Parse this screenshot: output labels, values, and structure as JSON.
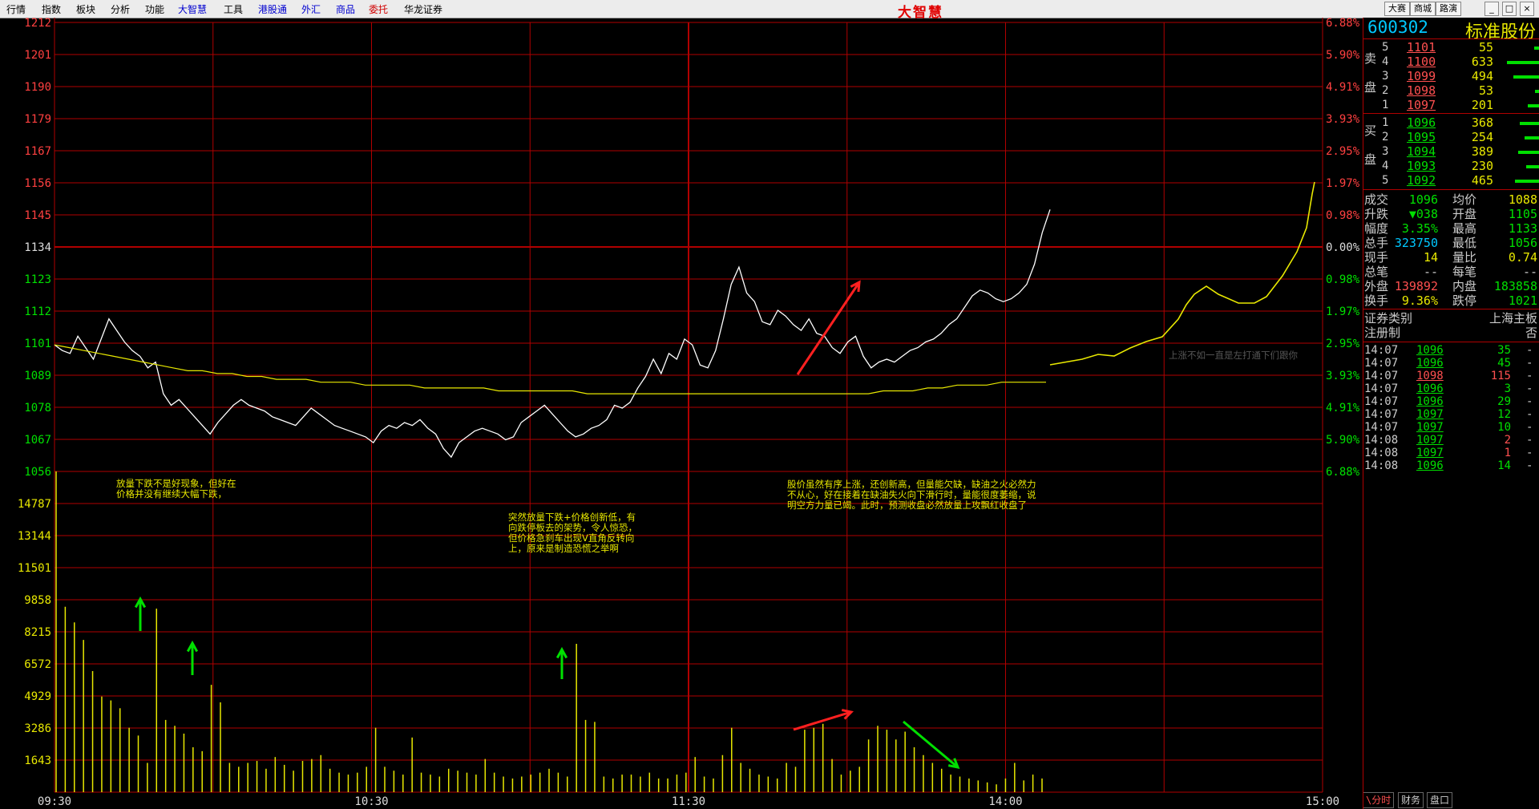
{
  "menu": [
    {
      "label": "行情",
      "style": ""
    },
    {
      "label": "指数",
      "style": ""
    },
    {
      "label": "板块",
      "style": ""
    },
    {
      "label": "分析",
      "style": ""
    },
    {
      "label": "功能",
      "style": ""
    },
    {
      "label": "大智慧",
      "style": "blue"
    },
    {
      "label": "工具",
      "style": ""
    },
    {
      "label": "港股通",
      "style": "blue"
    },
    {
      "label": "外汇",
      "style": "blue"
    },
    {
      "label": "商品",
      "style": "blue"
    },
    {
      "label": "委托",
      "style": "red"
    },
    {
      "label": "华龙证券",
      "style": ""
    }
  ],
  "logo": "大智慧",
  "topright": {
    "btn1": "大赛",
    "btn2": "商城",
    "btn3": "路演",
    "min": "_",
    "max": "□",
    "close": "×"
  },
  "stock": {
    "code": "600302",
    "name": "标准股份"
  },
  "orderbook": {
    "sell_side_label_1": "卖",
    "sell_side_label_2": "盘",
    "buy_side_label_1": "买",
    "buy_side_label_2": "盘",
    "sell": [
      {
        "level": "5",
        "price": "1101",
        "volume": "55",
        "bar": 0.15
      },
      {
        "level": "4",
        "price": "1100",
        "volume": "633",
        "bar": 1.0
      },
      {
        "level": "3",
        "price": "1099",
        "volume": "494",
        "bar": 0.8
      },
      {
        "level": "2",
        "price": "1098",
        "volume": "53",
        "bar": 0.12
      },
      {
        "level": "1",
        "price": "1097",
        "volume": "201",
        "bar": 0.35
      }
    ],
    "buy": [
      {
        "level": "1",
        "price": "1096",
        "volume": "368",
        "bar": 0.6
      },
      {
        "level": "2",
        "price": "1095",
        "volume": "254",
        "bar": 0.45
      },
      {
        "level": "3",
        "price": "1094",
        "volume": "389",
        "bar": 0.65
      },
      {
        "level": "4",
        "price": "1093",
        "volume": "230",
        "bar": 0.4
      },
      {
        "level": "5",
        "price": "1092",
        "volume": "465",
        "bar": 0.75
      }
    ]
  },
  "quote": [
    {
      "l1": "成交",
      "v1": "1096",
      "c1": "#00e000",
      "l2": "均价",
      "v2": "1088",
      "c2": "#e8e800"
    },
    {
      "l1": "升跌",
      "v1": "▼038",
      "c1": "#00e000",
      "l2": "开盘",
      "v2": "1105",
      "c2": "#00e000"
    },
    {
      "l1": "幅度",
      "v1": "3.35%",
      "c1": "#00e000",
      "l2": "最高",
      "v2": "1133",
      "c2": "#00e000"
    },
    {
      "l1": "总手",
      "v1": "323750",
      "c1": "#00c8ff",
      "l2": "最低",
      "v2": "1056",
      "c2": "#00e000"
    },
    {
      "l1": "现手",
      "v1": "14",
      "c1": "#e8e800",
      "l2": "量比",
      "v2": "0.74",
      "c2": "#e8e800"
    },
    {
      "l1": "总笔",
      "v1": "--",
      "c1": "#cccccc",
      "l2": "每笔",
      "v2": "--",
      "c2": "#cccccc"
    },
    {
      "l1": "外盘",
      "v1": "139892",
      "c1": "#ff5050",
      "l2": "内盘",
      "v2": "183858",
      "c2": "#00e000"
    },
    {
      "l1": "换手",
      "v1": "9.36%",
      "c1": "#e8e800",
      "l2": "跌停",
      "v2": "1021",
      "c2": "#00e000"
    }
  ],
  "info": {
    "l1": "证券类别",
    "v1": "上海主板",
    "l2": "注册制",
    "v2": "否"
  },
  "ticks": [
    {
      "time": "14:07",
      "price": "1096",
      "vol": "35",
      "vcolor": "#00e000",
      "flag": "-"
    },
    {
      "time": "14:07",
      "price": "1096",
      "vol": "45",
      "vcolor": "#00e000",
      "flag": "-"
    },
    {
      "time": "14:07",
      "price": "1098",
      "vol": "115",
      "vcolor": "#ff5050",
      "flag": "-"
    },
    {
      "time": "14:07",
      "price": "1096",
      "vol": "3",
      "vcolor": "#00e000",
      "flag": "-"
    },
    {
      "time": "14:07",
      "price": "1096",
      "vol": "29",
      "vcolor": "#00e000",
      "flag": "-"
    },
    {
      "time": "14:07",
      "price": "1097",
      "vol": "12",
      "vcolor": "#00e000",
      "flag": "-"
    },
    {
      "time": "14:07",
      "price": "1097",
      "vol": "10",
      "vcolor": "#00e000",
      "flag": "-"
    },
    {
      "time": "14:08",
      "price": "1097",
      "vol": "2",
      "vcolor": "#ff5050",
      "flag": "-"
    },
    {
      "time": "14:08",
      "price": "1097",
      "vol": "1",
      "vcolor": "#ff5050",
      "flag": "-"
    },
    {
      "time": "14:08",
      "price": "1096",
      "vol": "14",
      "vcolor": "#00e000",
      "flag": "-"
    }
  ],
  "panel_tabs": [
    {
      "label": "\\分时",
      "color": "#ff5050"
    },
    {
      "label": "财务",
      "color": "#cccccc"
    },
    {
      "label": "盘口",
      "color": "#cccccc"
    }
  ],
  "left_price_labels": [
    "1212",
    "1201",
    "1190",
    "1179",
    "1167",
    "1156",
    "1145",
    "1134",
    "1123",
    "1112",
    "1101",
    "1089",
    "1078",
    "1067",
    "1056"
  ],
  "right_pct_labels": [
    "6.88%",
    "5.90%",
    "4.91%",
    "3.93%",
    "2.95%",
    "1.97%",
    "0.98%",
    "0.00%",
    "0.98%",
    "1.97%",
    "2.95%",
    "3.93%",
    "4.91%",
    "5.90%",
    "6.88%"
  ],
  "volume_labels": [
    "14787",
    "13144",
    "11501",
    "9858",
    "8215",
    "6572",
    "4929",
    "3286",
    "1643"
  ],
  "time_labels": [
    "09:30",
    "10:30",
    "11:30",
    "14:00",
    "15:00"
  ],
  "annotations": [
    "放量下跌不是好现象，但好在\n价格并没有继续大幅下跌，",
    "突然放量下跌+价格创新低，有\n向跌停板去的架势，令人惊恐，\n但价格急刹车出现V直角反转向\n上，原来是制造恐慌之举啊",
    "股价虽然有序上涨，还创新高，但量能欠缺，缺油之火必然力\n不从心，好在接着在缺油失火向下滑行时，量能很度萎缩，说\n明空方力量已竭。此时，预测收盘必然放量上攻飘红收盘了",
    "上涨不如一直是左打通下们跟你"
  ],
  "chart_data": {
    "type": "line",
    "prev_close": 1134,
    "price_range": [
      1056,
      1212
    ],
    "volume_max": 16430,
    "price_series": [
      1100,
      1098,
      1097,
      1103,
      1099,
      1095,
      1102,
      1109,
      1105,
      1101,
      1098,
      1096,
      1092,
      1094,
      1083,
      1079,
      1081,
      1078,
      1075,
      1072,
      1069,
      1073,
      1076,
      1079,
      1081,
      1079,
      1078,
      1077,
      1075,
      1074,
      1073,
      1072,
      1075,
      1078,
      1076,
      1074,
      1072,
      1071,
      1070,
      1069,
      1068,
      1066,
      1070,
      1072,
      1071,
      1073,
      1072,
      1074,
      1071,
      1069,
      1064,
      1061,
      1066,
      1068,
      1070,
      1071,
      1070,
      1069,
      1067,
      1068,
      1073,
      1075,
      1077,
      1079,
      1076,
      1073,
      1070,
      1068,
      1069,
      1071,
      1072,
      1074,
      1079,
      1078,
      1080,
      1085,
      1089,
      1095,
      1090,
      1097,
      1095,
      1102,
      1100,
      1093,
      1092,
      1098,
      1109,
      1121,
      1127,
      1118,
      1115,
      1108,
      1107,
      1112,
      1110,
      1107,
      1105,
      1109,
      1104,
      1103,
      1099,
      1097,
      1101,
      1103,
      1096,
      1092,
      1094,
      1095,
      1094,
      1096,
      1098,
      1099,
      1101,
      1102,
      1104,
      1107,
      1109,
      1113,
      1117,
      1119,
      1118,
      1116,
      1115,
      1116,
      1118,
      1121,
      1128,
      1139,
      1147
    ],
    "avg_series": [
      1100,
      1099,
      1098,
      1097,
      1096,
      1095,
      1094,
      1093,
      1092,
      1091,
      1091,
      1090,
      1090,
      1089,
      1089,
      1088,
      1088,
      1088,
      1087,
      1087,
      1087,
      1086,
      1086,
      1086,
      1086,
      1085,
      1085,
      1085,
      1085,
      1085,
      1084,
      1084,
      1084,
      1084,
      1084,
      1084,
      1083,
      1083,
      1083,
      1083,
      1083,
      1083,
      1083,
      1083,
      1083,
      1083,
      1083,
      1083,
      1083,
      1083,
      1083,
      1083,
      1083,
      1083,
      1083,
      1083,
      1084,
      1084,
      1084,
      1085,
      1085,
      1086,
      1086,
      1086,
      1087,
      1087,
      1087,
      1087
    ],
    "volume_series": [
      16430,
      9500,
      8700,
      7800,
      6200,
      4900,
      4700,
      4300,
      3300,
      2900,
      1500,
      9400,
      3700,
      3400,
      3000,
      2300,
      2100,
      5500,
      4600,
      1500,
      1300,
      1500,
      1600,
      1200,
      1800,
      1400,
      1100,
      1600,
      1700,
      1900,
      1200,
      1000,
      900,
      1000,
      1300,
      3300,
      1300,
      1100,
      900,
      2800,
      1000,
      900,
      800,
      1200,
      1100,
      1000,
      900,
      1700,
      1000,
      800,
      700,
      800,
      900,
      1000,
      1200,
      1000,
      800,
      7600,
      3700,
      3600,
      800,
      700,
      900,
      900,
      800,
      1000,
      700,
      700,
      900,
      1000,
      1800,
      800,
      700,
      1900,
      3300,
      1500,
      1200,
      900,
      800,
      700,
      1500,
      1300,
      3200,
      3300,
      3500,
      1700,
      900,
      1100,
      1300,
      2700,
      3400,
      3200,
      2700,
      3100,
      2300,
      1900,
      1500,
      1200,
      900,
      800,
      700,
      600,
      500,
      400,
      700,
      1500,
      600,
      900,
      700
    ]
  }
}
